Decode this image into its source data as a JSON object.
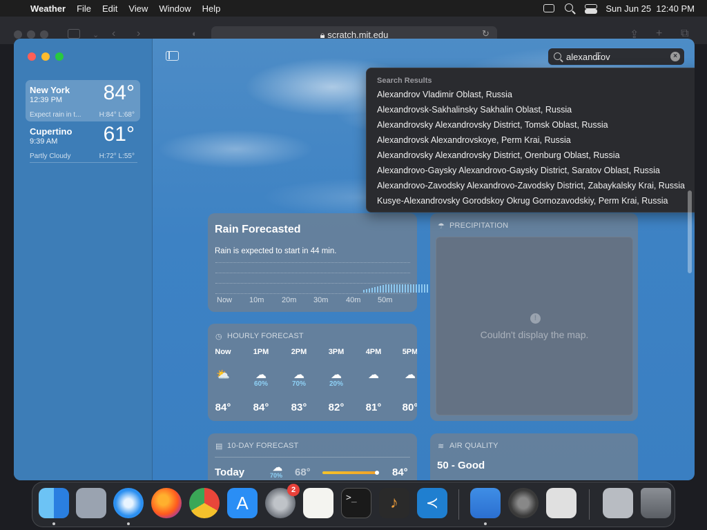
{
  "menubar": {
    "app_name": "Weather",
    "menus": [
      "File",
      "Edit",
      "View",
      "Window",
      "Help"
    ],
    "datetime": "Sun Jun 25  12:40 PM"
  },
  "browser": {
    "url": "scratch.mit.edu"
  },
  "sidebar": {
    "cities": [
      {
        "name": "New York",
        "time": "12:39 PM",
        "temp": "84°",
        "condition": "Expect rain in t...",
        "high_low": "H:84° L:68°"
      },
      {
        "name": "Cupertino",
        "time": "9:39 AM",
        "temp": "61°",
        "condition": "Partly Cloudy",
        "high_low": "H:72° L:55°"
      }
    ]
  },
  "search": {
    "value": "alexandrov"
  },
  "search_results": {
    "header": "Search Results",
    "items": [
      "Alexandrov Vladimir Oblast, Russia",
      "Alexandrovsk-Sakhalinsky Sakhalin Oblast, Russia",
      "Alexandrovsky Alexandrovsky District, Tomsk Oblast, Russia",
      "Alexandrovsk Alexandrovskoye, Perm Krai, Russia",
      "Alexandrovsky Alexandrovsky District, Orenburg Oblast, Russia",
      "Alexandrovo-Gaysky Alexandrovo-Gaysky District, Saratov Oblast, Russia",
      "Alexandrovo-Zavodsky Alexandrovo-Zavodsky District, Zabaykalsky Krai, Russia",
      "Kusye-Alexandrovsky Gorodskoy Okrug Gornozavodskiy, Perm Krai, Russia"
    ]
  },
  "rain_card": {
    "title": "Rain Forecasted",
    "subtitle": "Rain is expected to start in 44 min.",
    "ticks": [
      "Now",
      "10m",
      "20m",
      "30m",
      "40m",
      "50m"
    ]
  },
  "hourly": {
    "title": "HOURLY FORECAST",
    "hours": [
      {
        "label": "Now",
        "icon": "sun-cloud-icon",
        "pct": "",
        "temp": "84°"
      },
      {
        "label": "1PM",
        "icon": "rain-cloud-icon",
        "pct": "60%",
        "temp": "84°"
      },
      {
        "label": "2PM",
        "icon": "rain-cloud-icon",
        "pct": "70%",
        "temp": "83°"
      },
      {
        "label": "3PM",
        "icon": "rain-cloud-icon",
        "pct": "20%",
        "temp": "82°"
      },
      {
        "label": "4PM",
        "icon": "cloud-icon",
        "pct": "",
        "temp": "81°"
      },
      {
        "label": "5PM",
        "icon": "cloud-icon",
        "pct": "",
        "temp": "80°"
      }
    ]
  },
  "precipitation": {
    "title": "PRECIPITATION",
    "error": "Couldn't display the map."
  },
  "ten_day": {
    "title": "10-DAY FORECAST",
    "today": {
      "day": "Today",
      "pct": "70%",
      "low": "68°",
      "high": "84°"
    }
  },
  "air_quality": {
    "title": "AIR QUALITY",
    "value": "50 - Good"
  },
  "dock": {
    "apps": [
      "Finder",
      "Launchpad",
      "Safari",
      "Firefox",
      "Chrome",
      "App Store",
      "System Preferences",
      "TextEdit",
      "Terminal",
      "GarageBand",
      "VS Code",
      "Weather",
      "System Settings",
      "Automator",
      "Archive",
      "Trash"
    ],
    "badge": "2"
  },
  "colors": {
    "accent": "#4f8fd0",
    "rain": "#8ec9f0",
    "traffic_red": "#ff5f57",
    "traffic_yellow": "#febc2e",
    "traffic_green": "#28c840"
  }
}
